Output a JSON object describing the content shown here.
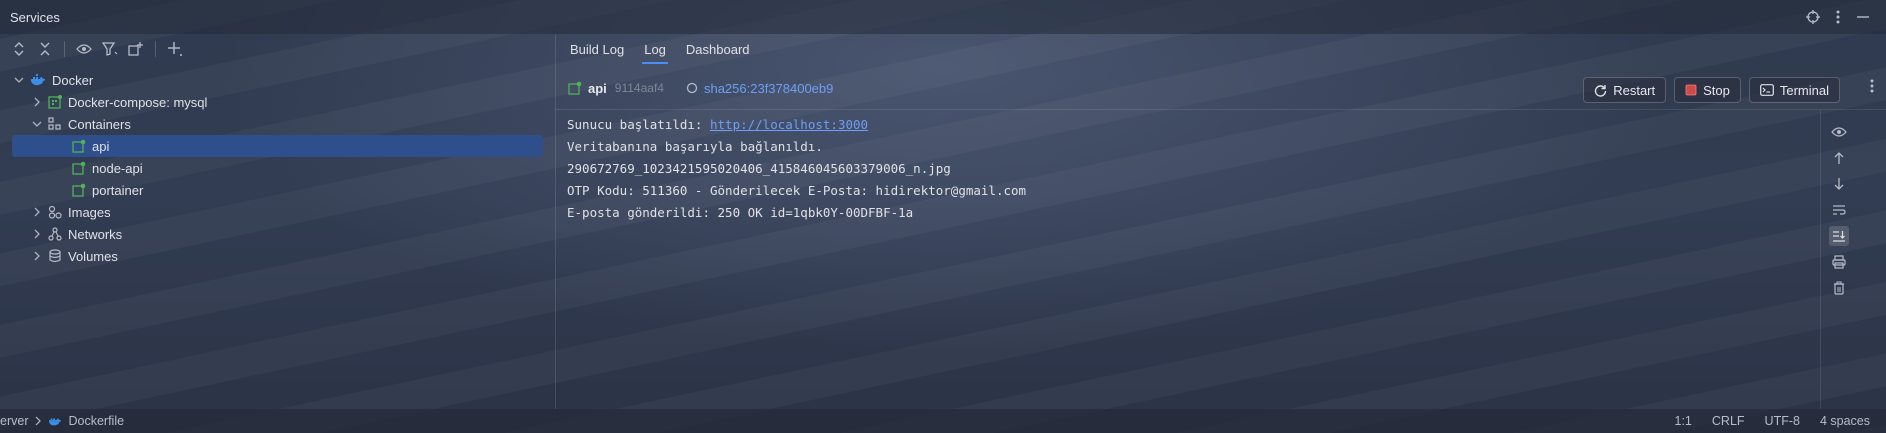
{
  "window": {
    "title": "Services"
  },
  "tree": {
    "root": "Docker",
    "compose": "Docker-compose: mysql",
    "containers_label": "Containers",
    "containers": [
      "api",
      "node-api",
      "portainer"
    ],
    "images": "Images",
    "networks": "Networks",
    "volumes": "Volumes"
  },
  "tabs": [
    "Build Log",
    "Log",
    "Dashboard"
  ],
  "active_tab": "Log",
  "container": {
    "name": "api",
    "short_id": "9114aaf4",
    "sha": "sha256:23f378400eb9"
  },
  "actions": {
    "restart": "Restart",
    "stop": "Stop",
    "terminal": "Terminal"
  },
  "log": {
    "line1_prefix": "Sunucu başlatıldı: ",
    "line1_link": "http://localhost:3000",
    "line2": "Veritabanına başarıyla bağlanıldı.",
    "line3": "290672769_1023421595020406_415846045603379006_n.jpg",
    "line4": "OTP Kodu: 511360 - Gönderilecek E-Posta: hidirektor@gmail.com",
    "line5": "E-posta gönderildi: 250 OK id=1qbk0Y-00DFBF-1a"
  },
  "statusbar": {
    "crumb1": "erver",
    "crumb2": "Dockerfile",
    "position": "1:1",
    "line_ending": "CRLF",
    "encoding": "UTF-8",
    "indent": "4 spaces"
  },
  "colors": {
    "accent": "#4a8df6",
    "selection": "#2f4e8c",
    "link": "#6e9ef5",
    "stop": "#d04a4a",
    "container_green": "#4fb15a"
  }
}
